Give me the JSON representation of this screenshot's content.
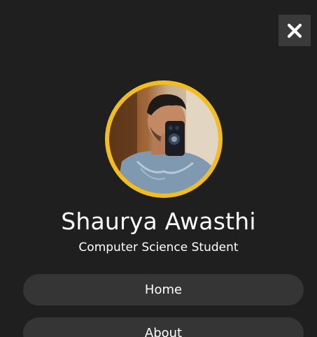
{
  "close": {
    "icon": "close-icon"
  },
  "profile": {
    "avatar_icon": "profile-photo",
    "ring_color": "#f2bd1d",
    "name": "Shaurya Awasthi",
    "role": "Computer Science Student"
  },
  "nav": {
    "items": [
      {
        "label": "Home"
      },
      {
        "label": "About"
      }
    ]
  }
}
